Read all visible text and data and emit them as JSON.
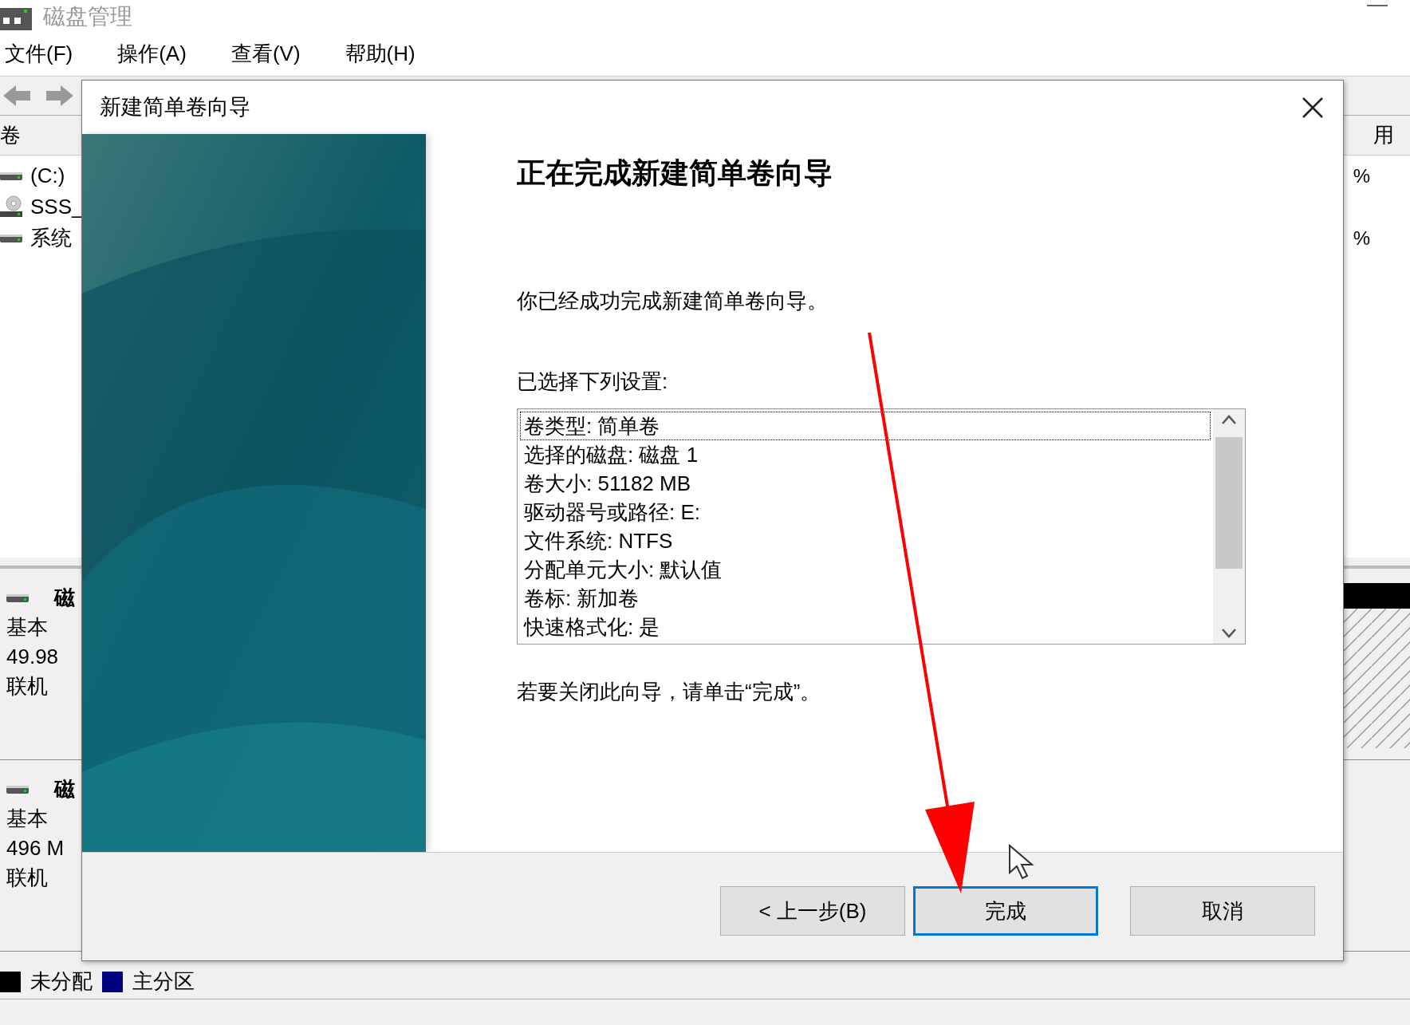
{
  "app": {
    "title": "磁盘管理",
    "menu": [
      {
        "label": "文件(F)"
      },
      {
        "label": "操作(A)"
      },
      {
        "label": "查看(V)"
      },
      {
        "label": "帮助(H)"
      }
    ]
  },
  "volume_list": {
    "columns": [
      "卷",
      "用"
    ],
    "rows": [
      {
        "name": "(C:)",
        "kind": "drive",
        "free": "%"
      },
      {
        "name": "SSS_",
        "kind": "cd"
      },
      {
        "name": "系统",
        "kind": "drive",
        "free": "%"
      }
    ]
  },
  "disks": [
    {
      "label": "磁",
      "type": "基本",
      "size": "49.98",
      "status": "联机"
    },
    {
      "label": "磁",
      "type": "基本",
      "size": "496 M",
      "status": "联机"
    }
  ],
  "legend": [
    {
      "label": "未分配",
      "color": "#000000"
    },
    {
      "label": "主分区",
      "color": "#000080"
    }
  ],
  "dialog": {
    "title": "新建简单卷向导",
    "heading": "正在完成新建简单卷向导",
    "message": "你已经成功完成新建简单卷向导。",
    "settings_label": "已选择下列设置:",
    "settings": [
      {
        "text": "卷类型: 简单卷",
        "selected": true
      },
      {
        "text": "选择的磁盘: 磁盘 1",
        "selected": false
      },
      {
        "text": "卷大小: 51182 MB",
        "selected": false
      },
      {
        "text": "驱动器号或路径: E:",
        "selected": false
      },
      {
        "text": "文件系统: NTFS",
        "selected": false
      },
      {
        "text": "分配单元大小: 默认值",
        "selected": false
      },
      {
        "text": "卷标: 新加卷",
        "selected": false
      },
      {
        "text": "快速格式化: 是",
        "selected": false
      }
    ],
    "close_hint": "若要关闭此向导，请单击“完成”。",
    "buttons": [
      {
        "label": "< 上一步(B)",
        "focused": false
      },
      {
        "label": "完成",
        "focused": true
      },
      {
        "label": "取消",
        "focused": false
      }
    ]
  }
}
